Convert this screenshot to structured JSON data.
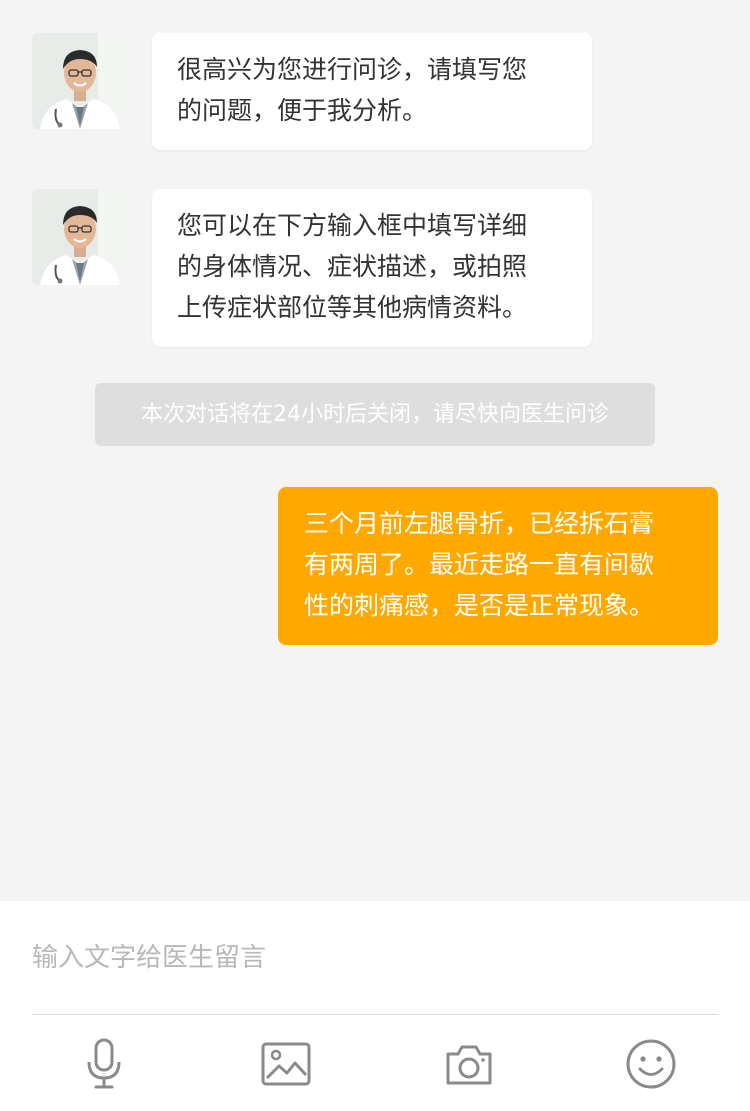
{
  "messages": [
    {
      "sender": "doctor",
      "lines": [
        "很高兴为您进行问诊，请填写您",
        "的问题，便于我分析。"
      ]
    },
    {
      "sender": "doctor",
      "lines": [
        "您可以在下方输入框中填写详细",
        "的身体情况、症状描述，或拍照",
        "上传症状部位等其他病情资料。"
      ]
    }
  ],
  "notice": {
    "text": "本次对话将在24小时后关闭，请尽快向医生问诊"
  },
  "user_message": {
    "lines": [
      "三个月前左腿骨折，已经拆石膏",
      "有两周了。最近走路一直有间歇",
      "性的刺痛感，是否是正常现象。"
    ]
  },
  "composer": {
    "placeholder": "输入文字给医生留言",
    "value": ""
  },
  "toolbar": [
    {
      "icon": "microphone-icon"
    },
    {
      "icon": "image-icon"
    },
    {
      "icon": "camera-icon"
    },
    {
      "icon": "emoji-icon"
    }
  ],
  "colors": {
    "background": "#f4f4f4",
    "user_bubble": "#ffa800",
    "notice": "#dedede",
    "icon": "#8a8a8a"
  }
}
